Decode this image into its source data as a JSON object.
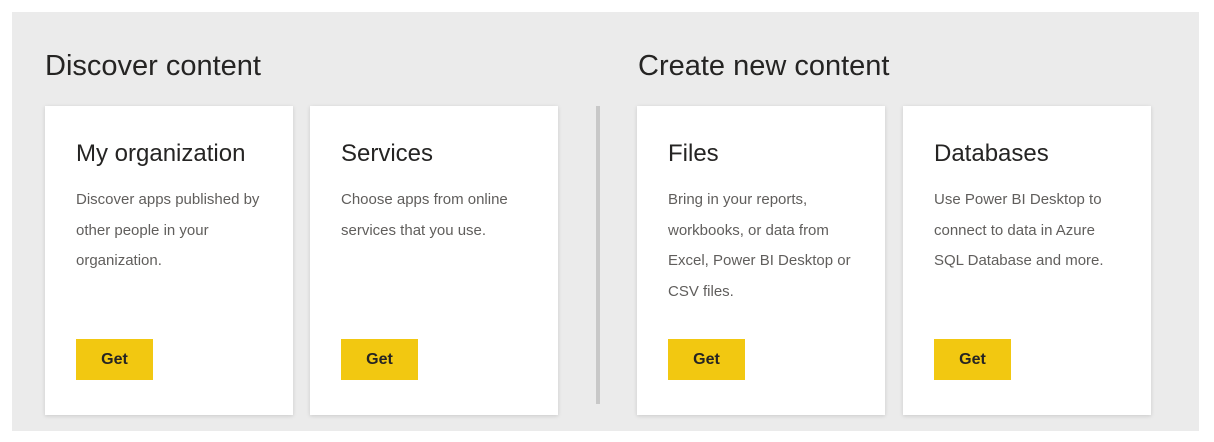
{
  "discover": {
    "title": "Discover content",
    "cards": [
      {
        "title": "My organization",
        "description": "Discover apps published by other people in your organization.",
        "button_label": "Get"
      },
      {
        "title": "Services",
        "description": "Choose apps from online services that you use.",
        "button_label": "Get"
      }
    ]
  },
  "create": {
    "title": "Create new content",
    "cards": [
      {
        "title": "Files",
        "description": "Bring in your reports, workbooks, or data from Excel, Power BI Desktop or CSV files.",
        "button_label": "Get"
      },
      {
        "title": "Databases",
        "description": "Use Power BI Desktop to connect to data in Azure SQL Database and more.",
        "button_label": "Get"
      }
    ]
  },
  "colors": {
    "panel_background": "#ebebeb",
    "card_background": "#ffffff",
    "button_accent": "#f2c811",
    "title_text": "#252423",
    "body_text": "#605e5c",
    "divider": "#c8c8c8"
  }
}
